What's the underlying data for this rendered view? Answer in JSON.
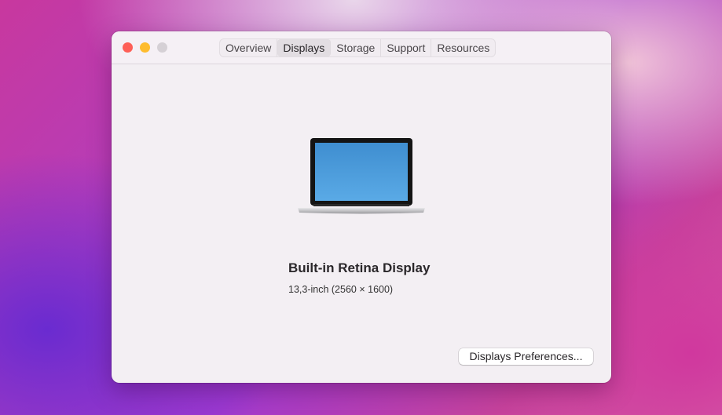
{
  "tabs": [
    {
      "label": "Overview"
    },
    {
      "label": "Displays",
      "active": true
    },
    {
      "label": "Storage"
    },
    {
      "label": "Support"
    },
    {
      "label": "Resources"
    }
  ],
  "display": {
    "name": "Built-in Retina Display",
    "spec": "13,3-inch (2560 × 1600)",
    "icon": "laptop-icon"
  },
  "buttons": {
    "preferences": "Displays Preferences..."
  },
  "colors": {
    "close": "#fe5f57",
    "minimize": "#febc2e",
    "zoom": "#d5d0d5"
  }
}
